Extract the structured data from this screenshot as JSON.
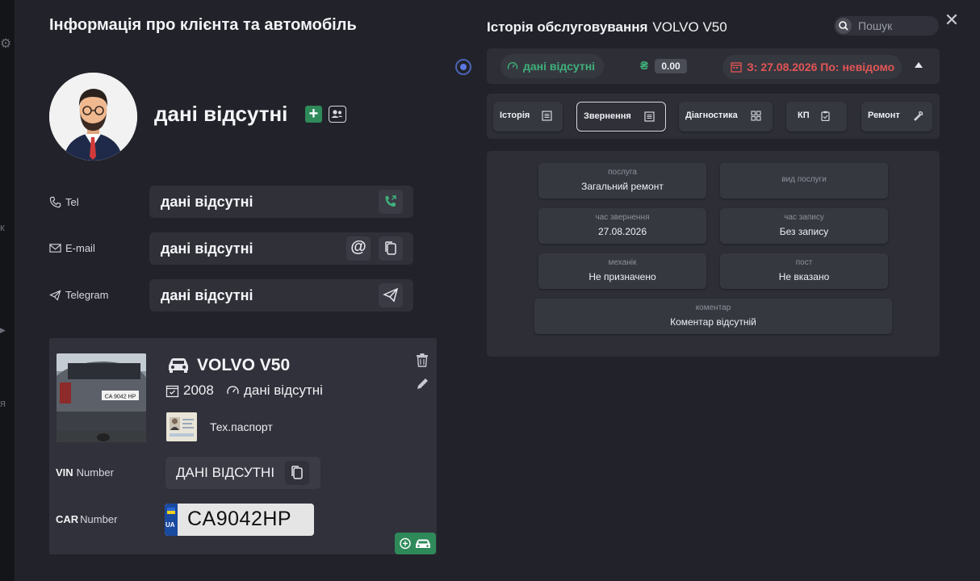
{
  "left_panel": {
    "title": "Інформація про клієнта та автомобіль",
    "client_name": "дані відсутні",
    "add_label": "+",
    "fields": {
      "tel": {
        "label": "Tel",
        "value": "дані відсутні"
      },
      "email": {
        "label": "E-mail",
        "value": "дані відсутні"
      },
      "telegram": {
        "label": "Telegram",
        "value": "дані відсутні"
      }
    }
  },
  "car": {
    "title": "VOLVO V50",
    "year": "2008",
    "mileage": "дані відсутні",
    "passport_label": "Тех.паспорт",
    "vin_label_bold": "VIN",
    "vin_label": "Number",
    "vin_value": "ДАНІ ВІДСУТНІ",
    "car_label_bold": "CAR",
    "car_label": "Number",
    "plate_country": "UA",
    "plate_number": "CA9042HP",
    "photo_plate": "CA 9042 HP"
  },
  "right_panel": {
    "title": "Історія обслуговування",
    "vehicle": "VOLVO V50",
    "search_placeholder": "Пошук",
    "status": "дані відсутні",
    "currency": "₴",
    "amount": "0.00",
    "date_range": "З: 27.08.2026  По: невідомо",
    "tabs": [
      {
        "label": "Історія"
      },
      {
        "label": "Звернення"
      },
      {
        "label": "Діагностика"
      },
      {
        "label": "КП"
      },
      {
        "label": "Ремонт"
      }
    ],
    "details": {
      "service": {
        "caption": "послуга",
        "value": "Загальний ремонт"
      },
      "service_type": {
        "caption": "вид послуги",
        "value": ""
      },
      "request_time": {
        "caption": "час звернення",
        "value": "27.08.2026"
      },
      "booking_time": {
        "caption": "час запису",
        "value": "Без запису"
      },
      "mechanic": {
        "caption": "механік",
        "value": "Не призначено"
      },
      "post": {
        "caption": "пост",
        "value": "Не вказано"
      },
      "comment": {
        "caption": "коментар",
        "value": "Коментар відсутній"
      }
    }
  },
  "background": {
    "glyph_k": "к",
    "glyph_ya": "я"
  },
  "colors": {
    "accent_green": "#3fb07a",
    "accent_red": "#e25555",
    "button_green": "#2f8a5a",
    "panel": "#2d2e36"
  }
}
